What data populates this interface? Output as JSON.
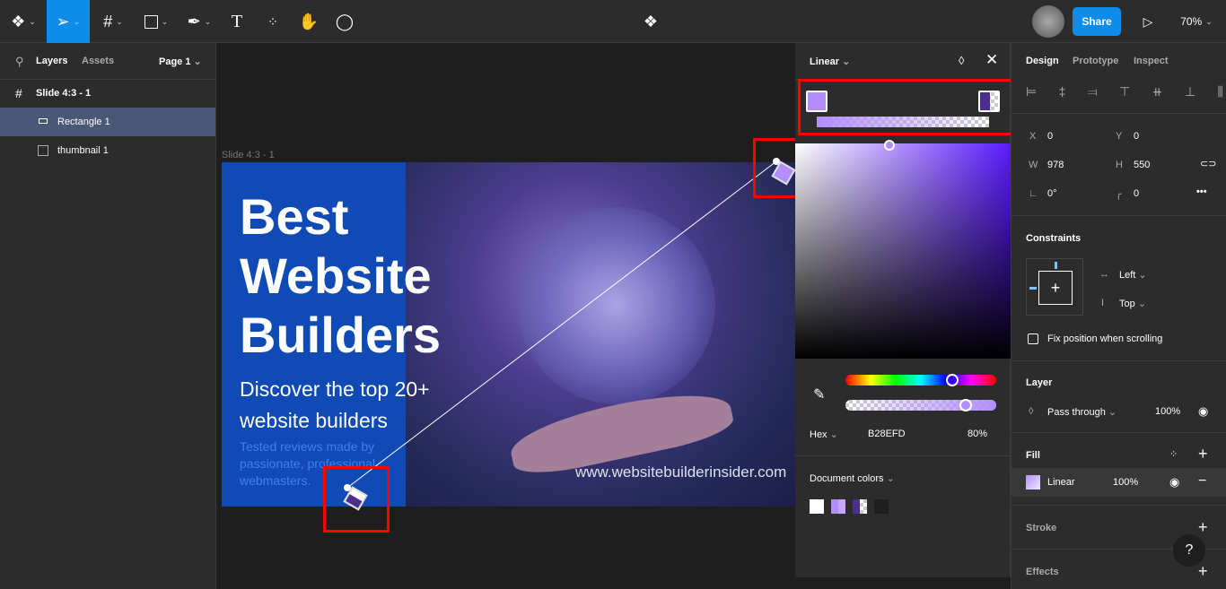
{
  "toolbar": {
    "tools": [
      "figma-menu",
      "move",
      "frame",
      "rectangle",
      "pen",
      "text",
      "resources",
      "hand",
      "comment"
    ],
    "share_label": "Share",
    "zoom": "70%"
  },
  "left_panel": {
    "tabs": [
      "Layers",
      "Assets"
    ],
    "page": "Page 1",
    "layers": [
      {
        "name": "Slide 4:3 - 1",
        "type": "frame"
      },
      {
        "name": "Rectangle 1",
        "type": "rectangle",
        "selected": true
      },
      {
        "name": "thumbnail 1",
        "type": "image"
      }
    ]
  },
  "canvas": {
    "frame_label": "Slide 4:3 - 1",
    "slide": {
      "title_lines": [
        "Best",
        "Website",
        "Builders"
      ],
      "subtitle_lines": [
        "Discover the top 20+",
        "website builders"
      ],
      "tagline_lines": [
        "Tested reviews made by",
        "passionate, professional",
        "webmasters."
      ],
      "url": "www.websitebuilderinsider.com"
    }
  },
  "picker": {
    "type": "Linear",
    "hex_label": "Hex",
    "hex": "B28EFD",
    "opacity": "80%",
    "hue_fraction": 0.71,
    "alpha_fraction": 0.8,
    "document_colors_label": "Document colors",
    "stop_color": "#B28EFD",
    "end_color": "#4B2E8E"
  },
  "design": {
    "tabs": [
      "Design",
      "Prototype",
      "Inspect"
    ],
    "x_label": "X",
    "x": "0",
    "y_label": "Y",
    "y": "0",
    "w_label": "W",
    "w": "978",
    "h_label": "H",
    "h": "550",
    "rotation": "0°",
    "radius": "0",
    "constraints_title": "Constraints",
    "constraint_h": "Left",
    "constraint_v": "Top",
    "fix_position": "Fix position when scrolling",
    "layer_title": "Layer",
    "blend": "Pass through",
    "layer_opacity": "100%",
    "fill_title": "Fill",
    "fill_type": "Linear",
    "fill_opacity": "100%",
    "stroke_title": "Stroke",
    "effects_title": "Effects",
    "help": "?"
  }
}
